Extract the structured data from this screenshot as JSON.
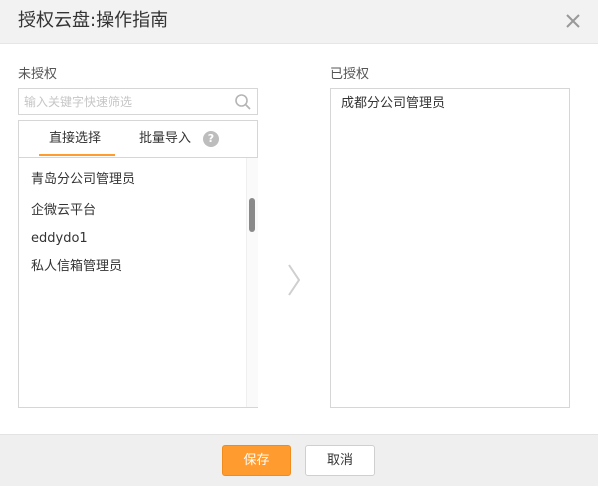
{
  "dialog": {
    "title": "授权云盘:操作指南"
  },
  "unauthorized": {
    "label": "未授权",
    "search_placeholder": "输入关键字快速筛选",
    "tabs": [
      {
        "label": "直接选择",
        "active": true
      },
      {
        "label": "批量导入",
        "active": false
      }
    ],
    "help_text": "?",
    "items": [
      "青岛分公司管理员",
      "企微云平台",
      "eddydo1",
      "私人信箱管理员"
    ]
  },
  "authorized": {
    "label": "已授权",
    "items": [
      "成都分公司管理员"
    ]
  },
  "footer": {
    "save_label": "保存",
    "cancel_label": "取消"
  },
  "colors": {
    "accent": "#ff9b2f",
    "header_bg": "#f2f2f2",
    "footer_bg": "#efefef",
    "border": "#d6d6d6"
  },
  "icons": {
    "close": "close-icon",
    "search": "search-icon",
    "help": "help-icon",
    "transfer": "chevron-right-icon"
  }
}
